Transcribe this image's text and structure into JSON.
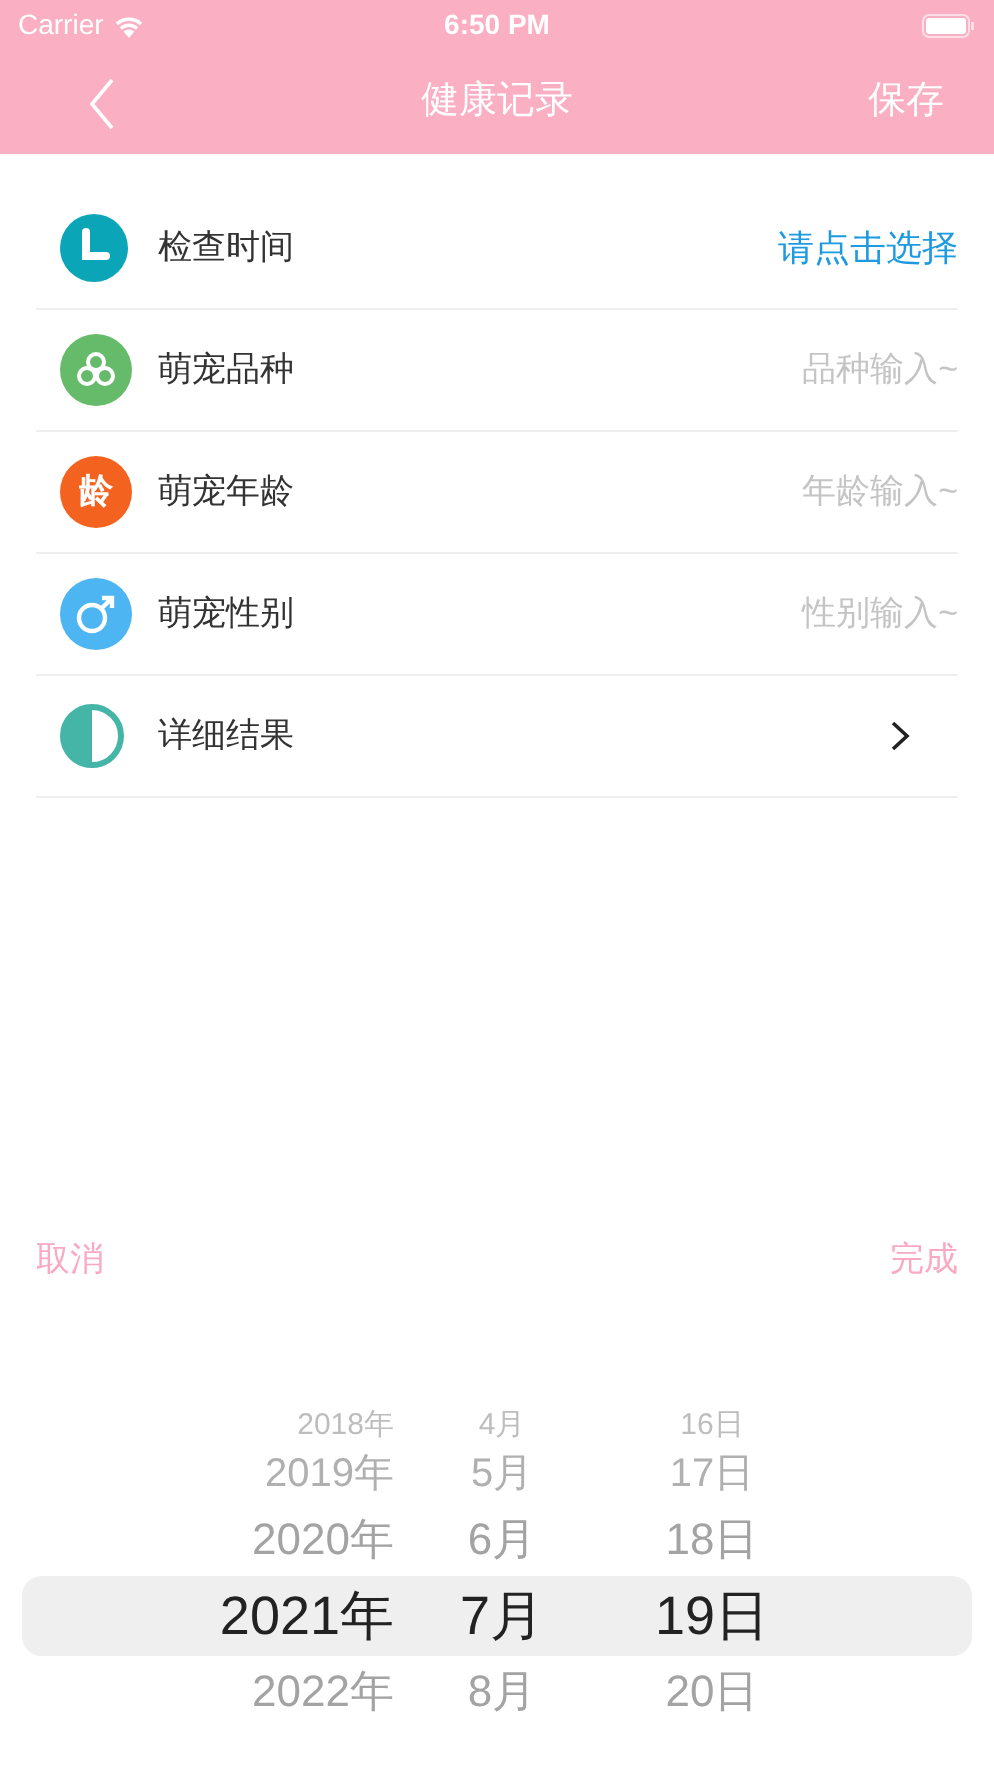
{
  "status_bar": {
    "carrier": "Carrier",
    "time": "6:50 PM"
  },
  "nav": {
    "title": "健康记录",
    "action": "保存"
  },
  "rows": [
    {
      "kind": "select",
      "label": "检查时间",
      "value": "请点击选择"
    },
    {
      "kind": "input",
      "label": "萌宠品种",
      "placeholder": "品种输入~"
    },
    {
      "kind": "input",
      "icon_text": "龄",
      "label": "萌宠年龄",
      "placeholder": "年龄输入~"
    },
    {
      "kind": "input",
      "label": "萌宠性别",
      "placeholder": "性别输入~"
    },
    {
      "kind": "link",
      "label": "详细结果"
    }
  ],
  "picker": {
    "cancel": "取消",
    "done": "完成",
    "rows": [
      {
        "year": "2018年",
        "month": "4月",
        "day": "16日",
        "selected": false
      },
      {
        "year": "2019年",
        "month": "5月",
        "day": "17日",
        "selected": false
      },
      {
        "year": "2020年",
        "month": "6月",
        "day": "18日",
        "selected": false
      },
      {
        "year": "2021年",
        "month": "7月",
        "day": "19日",
        "selected": true
      },
      {
        "year": "2022年",
        "month": "8月",
        "day": "20日",
        "selected": false
      }
    ]
  }
}
